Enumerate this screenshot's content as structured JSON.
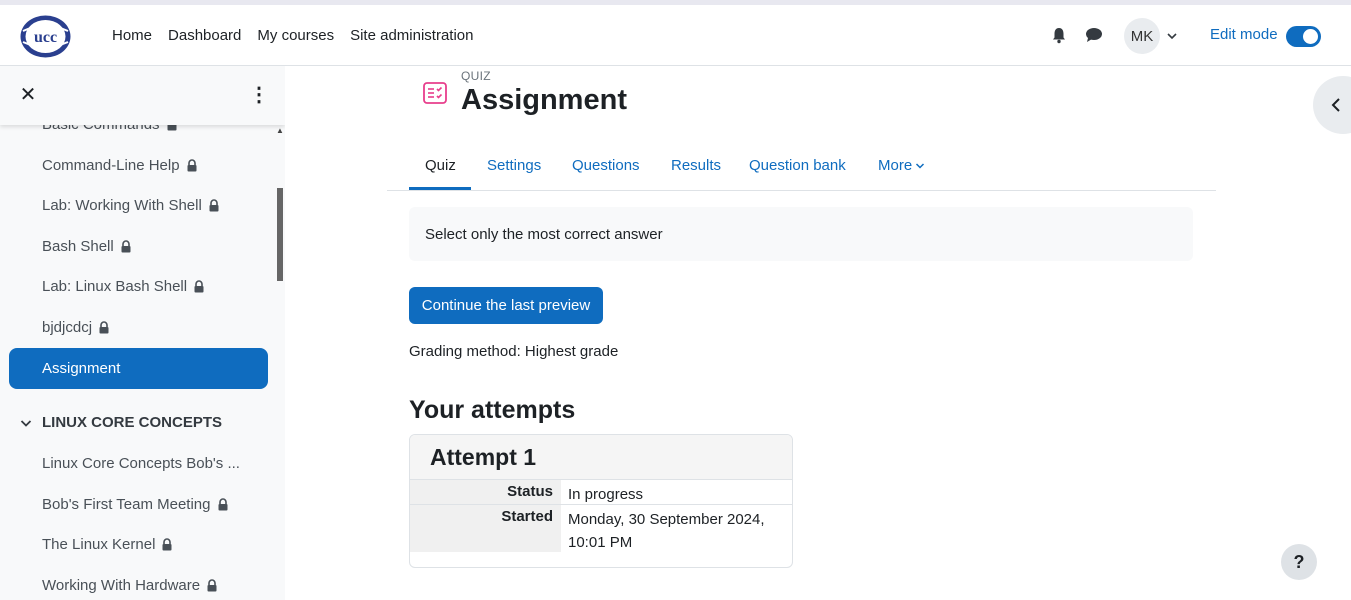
{
  "navbar": {
    "logo_text": "UCC",
    "links": [
      "Home",
      "Dashboard",
      "My courses",
      "Site administration"
    ],
    "user_initials": "MK",
    "edit_mode_label": "Edit mode",
    "edit_mode_on": true
  },
  "drawer": {
    "items": [
      {
        "label": "Basic Commands",
        "locked": true
      },
      {
        "label": "Command-Line Help",
        "locked": true
      },
      {
        "label": "Lab: Working With Shell",
        "locked": true
      },
      {
        "label": "Bash Shell",
        "locked": true
      },
      {
        "label": "Lab: Linux Bash Shell",
        "locked": true
      },
      {
        "label": "bjdjcdcj",
        "locked": true
      }
    ],
    "active_item": "Assignment",
    "section_title": "LINUX CORE CONCEPTS",
    "section_items": [
      {
        "label": "Linux Core Concepts Bob's ...",
        "locked": false
      },
      {
        "label": "Bob's First Team Meeting",
        "locked": true
      },
      {
        "label": "The Linux Kernel",
        "locked": true
      },
      {
        "label": "Working With Hardware",
        "locked": true
      }
    ]
  },
  "page": {
    "module_type": "QUIZ",
    "title": "Assignment",
    "tabs": [
      "Quiz",
      "Settings",
      "Questions",
      "Results",
      "Question bank",
      "More"
    ],
    "active_tab": "Quiz",
    "intro": "Select only the most correct answer",
    "continue_button": "Continue the last preview",
    "grading_method": "Grading method: Highest grade",
    "attempts_heading": "Your attempts",
    "attempt": {
      "title": "Attempt 1",
      "status_label": "Status",
      "status_value": "In progress",
      "started_label": "Started",
      "started_value": "Monday, 30 September 2024, 10:01 PM"
    }
  },
  "help_label": "?",
  "colors": {
    "primary": "#0f6cbf",
    "quiz_icon": "#e83e8c",
    "drawer_bg": "#f8f9fa"
  }
}
